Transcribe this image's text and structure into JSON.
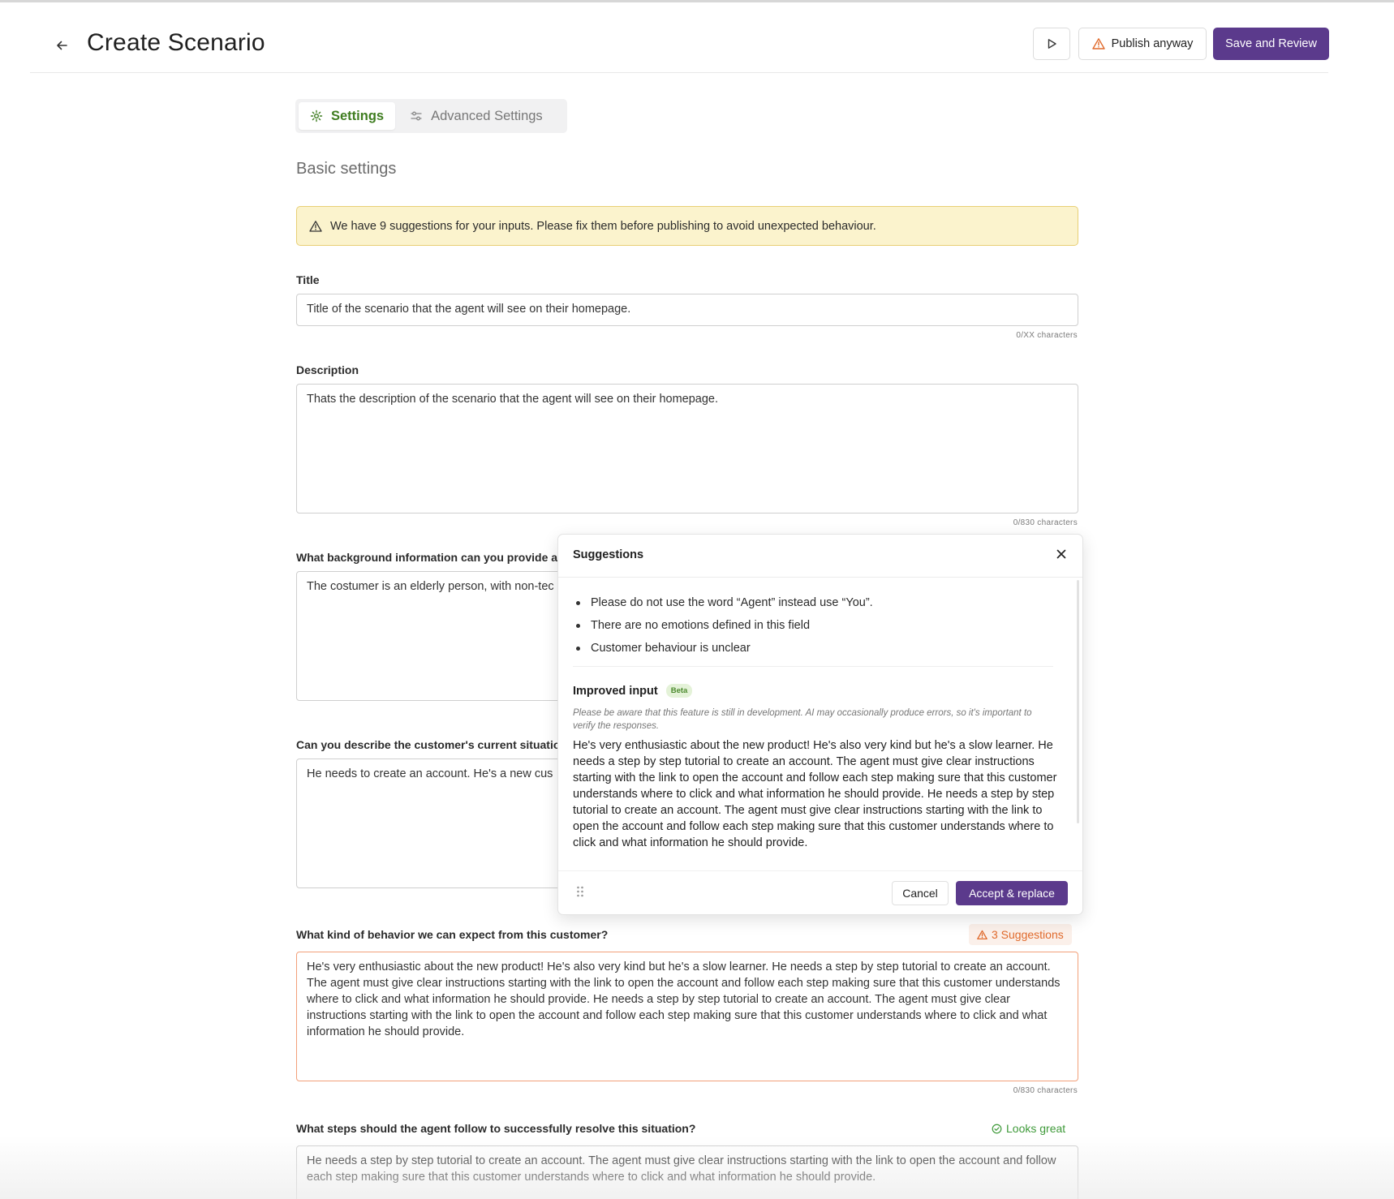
{
  "header": {
    "title": "Create Scenario",
    "publish_label": "Publish anyway",
    "save_label": "Save and Review"
  },
  "tabs": [
    {
      "label": "Settings",
      "icon": "gear-icon",
      "active": true
    },
    {
      "label": "Advanced Settings",
      "icon": "sliders-icon",
      "active": false
    }
  ],
  "section_title": "Basic settings",
  "alert": {
    "text": "We have 9 suggestions for your inputs. Please fix them before publishing to avoid unexpected behaviour.",
    "color": "#fbf3cd"
  },
  "fields": {
    "title": {
      "label": "Title",
      "value": "Title of the scenario that the agent will see on their homepage.",
      "counter": "0/XX characters"
    },
    "description": {
      "label": "Description",
      "value": "Thats the description of the scenario that the agent will see on their homepage.",
      "counter": "0/830 characters"
    },
    "background": {
      "label": "What background information can you provide ab",
      "value": "The costumer is an elderly person, with non-tec"
    },
    "situation": {
      "label": "Can you describe the customer's current situatio",
      "value": "He needs to create an account. He's a new cus"
    },
    "behavior": {
      "label": "What kind of behavior we can expect from this customer?",
      "badge": "3 Suggestions",
      "value": "He's very enthusiastic about the new product! He's also very kind but he's a slow learner.  He needs a step by step tutorial to create an account. The agent must give clear instructions starting with the link to open the account and follow each step making sure that this customer understands where to click and what information he should provide.  He needs a step by step tutorial to create an account. The agent must give clear instructions starting with the link to open the account and follow each step making sure that this customer understands where to click and what information he should provide.",
      "counter": "0/830 characters"
    },
    "steps": {
      "label": "What steps should the agent follow to successfully resolve this situation?",
      "badge": "Looks great",
      "value": "He needs a step by step tutorial to create an account. The agent must give clear instructions starting with the link to open the account and follow each step making sure that this customer understands where to click and what information he should provide."
    }
  },
  "suggestions_popover": {
    "title": "Suggestions",
    "items": [
      "Please do not use the word “Agent” instead use “You”.",
      "There are no emotions defined in this field",
      "Customer behaviour is unclear"
    ],
    "improved_label": "Improved input",
    "beta_label": "Beta",
    "disclaimer": "Please be aware that this feature is still in development. AI may occasionally produce errors, so it's important to verify the responses.",
    "improved_text": "He's very enthusiastic about the new product! He's also very kind but he's a slow learner. He needs a step by step tutorial to create an account. The agent must give clear instructions starting with the link to open the account and follow each step making sure that this customer understands where to click and what information he should provide.  He needs a step by step tutorial to create an account. The agent must give clear instructions starting with the link to open the account and follow each step making sure that this customer understands where to click and what information he should provide.",
    "cancel_label": "Cancel",
    "accept_label": "Accept & replace"
  },
  "colors": {
    "primary": "#5b3a8c",
    "success": "#3f7d20",
    "warning": "#e06a2c"
  }
}
